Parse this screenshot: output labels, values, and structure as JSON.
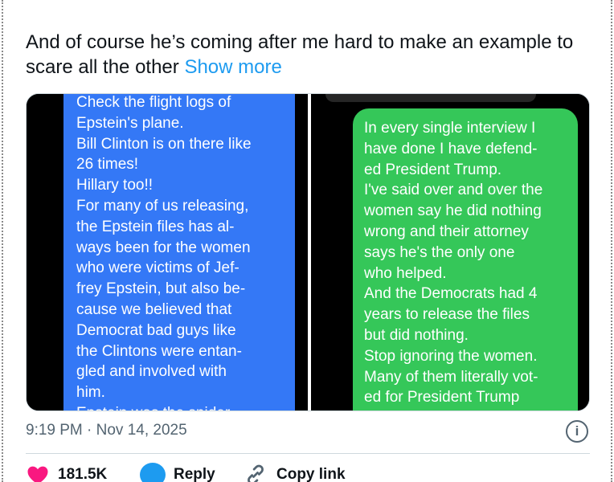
{
  "tweet": {
    "text": "And of course he’s coming after me hard to make an example to scare all the other",
    "show_more": "Show more"
  },
  "media": {
    "left_message": "Check the flight logs of\nEpstein's plane.\nBill Clinton is on there like\n26 times!\nHillary too!!\nFor many of us releasing,\nthe Epstein files has al-\nways been for the women\nwho were victims of Jef-\nfrey Epstein, but also be-\ncause we believed that\nDemocrat bad guys like\nthe Clintons were entan-\ngled and involved with\nhim.\nEpstein was the spider",
    "right_message": "In every single interview I\nhave done I have defend-\ned President Trump.\nI've said over and over the\nwomen say he did nothing\nwrong and their attorney\nsays he's the only one\nwho helped.\nAnd the Democrats had 4\nyears to release the files\nbut did nothing.\nStop ignoring the women.\nMany of them literally vot-\ned for President Trump",
    "left_bubble_color": "#3478f6",
    "right_bubble_color": "#35c759"
  },
  "meta": {
    "timestamp": "9:19 PM · Nov 14, 2025",
    "info_icon": "i"
  },
  "actions": {
    "like_count": "181.5K",
    "like_color": "#f91880",
    "reply_label": "Reply",
    "copy_link_label": "Copy link",
    "icons": [
      "heart-icon",
      "reply-icon",
      "link-icon"
    ]
  }
}
